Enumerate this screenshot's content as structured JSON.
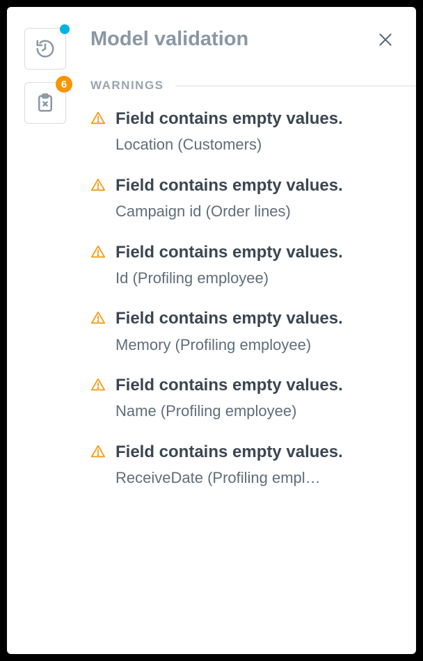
{
  "colors": {
    "warning": "#f59c1a",
    "badge": "#f89406",
    "dot": "#00b4e0"
  },
  "rail": {
    "badge_count": "6"
  },
  "panel": {
    "title": "Model validation",
    "section_label": "WARNINGS"
  },
  "warnings": [
    {
      "title": "Field contains empty values.",
      "detail": "Location (Customers)"
    },
    {
      "title": "Field contains empty values.",
      "detail": "Campaign id (Order lines)"
    },
    {
      "title": "Field contains empty values.",
      "detail": "Id (Profiling employee)"
    },
    {
      "title": "Field contains empty values.",
      "detail": "Memory (Profiling employee)"
    },
    {
      "title": "Field contains empty values.",
      "detail": "Name (Profiling employee)"
    },
    {
      "title": "Field contains empty values.",
      "detail": "ReceiveDate (Profiling empl…"
    }
  ]
}
